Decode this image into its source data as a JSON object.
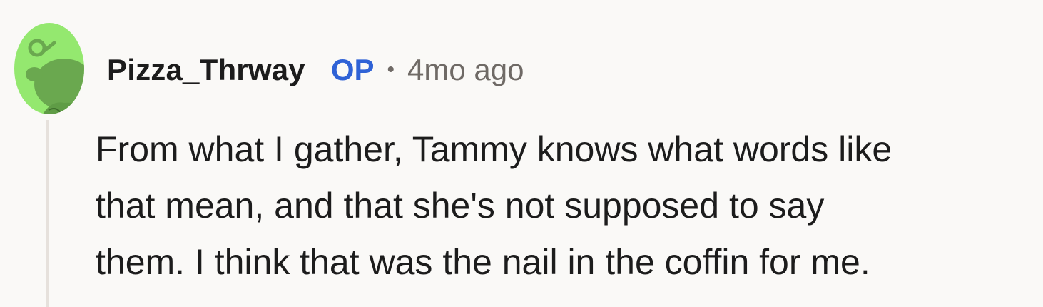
{
  "comment": {
    "username": "Pizza_Thrway",
    "op_badge": "OP",
    "separator": "•",
    "timestamp": "4mo ago",
    "body_lines": [
      "From what I gather, Tammy knows what words like",
      "that mean, and that she's not supposed to say",
      "them. I think that was the nail in the coffin for me."
    ]
  },
  "colors": {
    "background": "#faf9f7",
    "avatar_bg": "#94e86f",
    "avatar_snoo": "#6aa84f",
    "op_blue": "#2f62d6",
    "meta_gray": "#6f6a66",
    "thread_line": "#e6e1dc"
  },
  "icons": {
    "avatar": "snoo-avatar-icon"
  }
}
